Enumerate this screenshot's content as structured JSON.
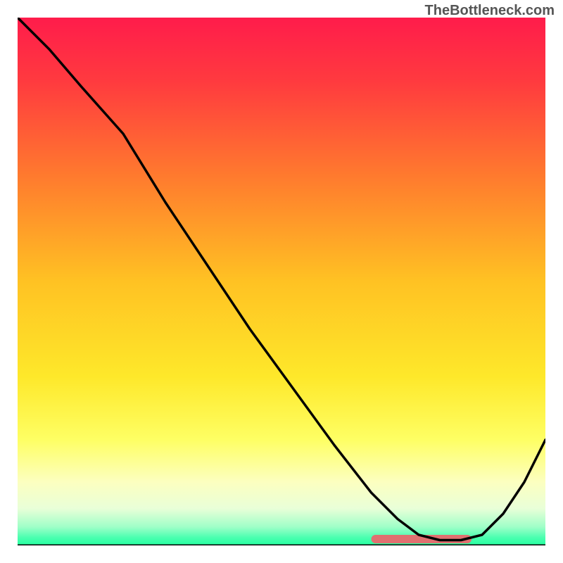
{
  "watermark": "TheBottleneck.com",
  "chart_data": {
    "type": "line",
    "title": "",
    "xlabel": "",
    "ylabel": "",
    "x_range": [
      0,
      100
    ],
    "y_range": [
      0,
      100
    ],
    "gradient_stops": [
      {
        "offset": 0,
        "color": "#ff1c4b"
      },
      {
        "offset": 0.12,
        "color": "#ff3a3f"
      },
      {
        "offset": 0.3,
        "color": "#ff7a2e"
      },
      {
        "offset": 0.5,
        "color": "#ffc223"
      },
      {
        "offset": 0.68,
        "color": "#fee82a"
      },
      {
        "offset": 0.8,
        "color": "#feff64"
      },
      {
        "offset": 0.88,
        "color": "#fcffc0"
      },
      {
        "offset": 0.93,
        "color": "#e9ffd8"
      },
      {
        "offset": 0.965,
        "color": "#9fffc8"
      },
      {
        "offset": 0.985,
        "color": "#4bffb0"
      },
      {
        "offset": 1.0,
        "color": "#25ff9f"
      }
    ],
    "series": [
      {
        "name": "curve",
        "color": "#000000",
        "x": [
          0,
          6,
          12,
          20,
          28,
          36,
          44,
          52,
          60,
          67,
          72,
          76,
          80,
          84,
          88,
          92,
          96,
          100
        ],
        "y": [
          100,
          94,
          87,
          78,
          65,
          53,
          41,
          30,
          19,
          10,
          5,
          2,
          1,
          1,
          2,
          6,
          12,
          20
        ]
      }
    ],
    "marker_band": {
      "name": "optimal-range",
      "color": "#e07070",
      "x_start": 67,
      "x_end": 86,
      "y": 1.2,
      "thickness": 1.6
    },
    "baseline": {
      "color": "#000000",
      "y": 0
    }
  }
}
